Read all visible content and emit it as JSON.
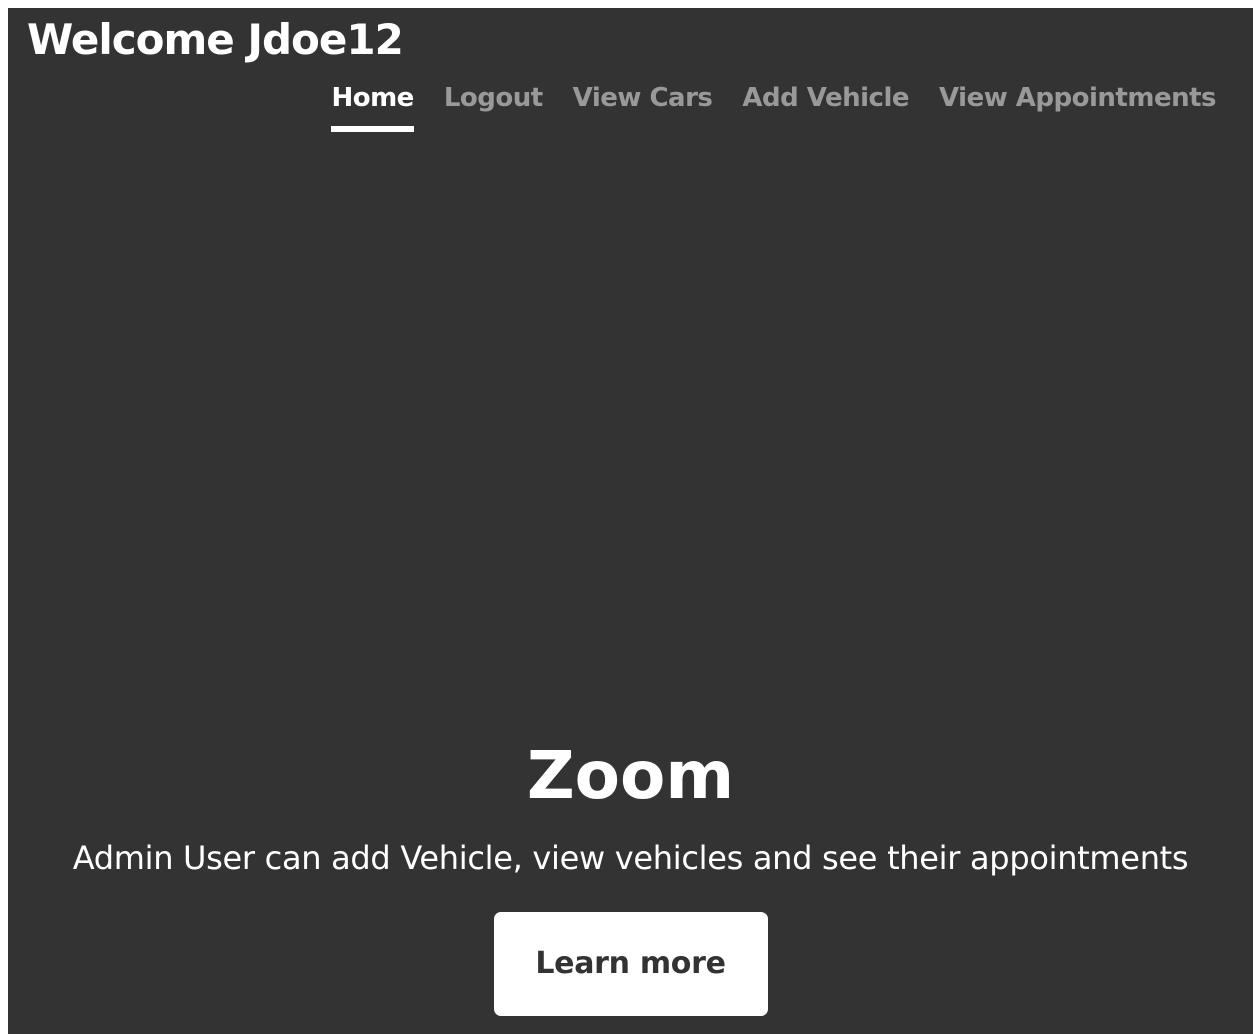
{
  "header": {
    "brand": "Welcome Jdoe12"
  },
  "nav": {
    "items": [
      {
        "label": "Home",
        "active": true
      },
      {
        "label": "Logout",
        "active": false
      },
      {
        "label": "View Cars",
        "active": false
      },
      {
        "label": "Add Vehicle",
        "active": false
      },
      {
        "label": "View Appointments",
        "active": false
      }
    ]
  },
  "hero": {
    "title": "Zoom",
    "subtitle": "Admin User can add Vehicle, view vehicles and see their appointments",
    "button_label": "Learn more"
  },
  "colors": {
    "background": "#333333",
    "text": "#ffffff",
    "muted_nav": "rgba(255,255,255,0.5)",
    "button_bg": "#ffffff",
    "button_text": "#333333"
  }
}
